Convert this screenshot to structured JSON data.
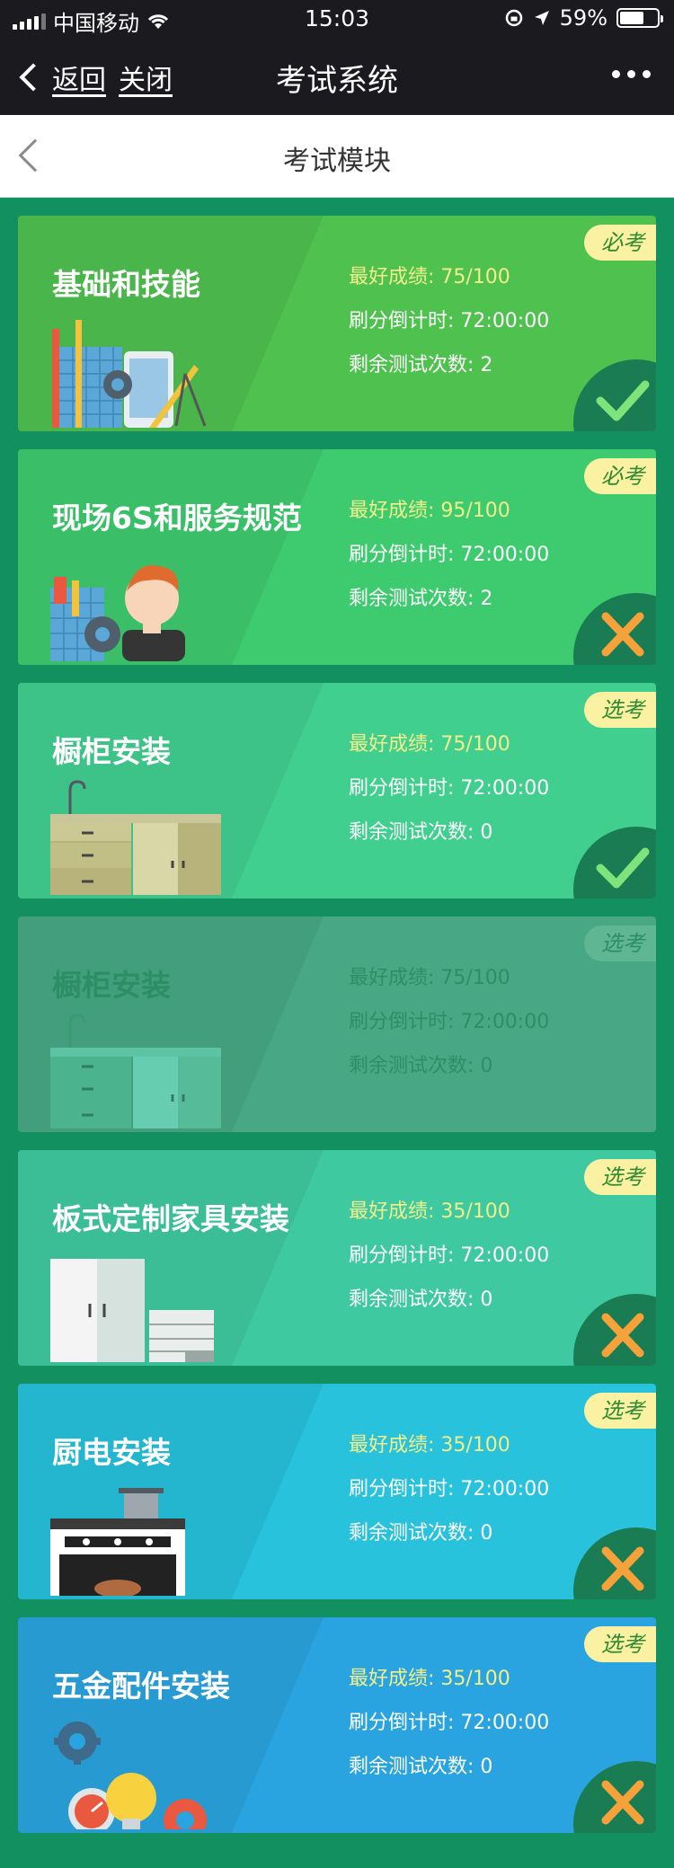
{
  "status": {
    "carrier": "中国移动",
    "time": "15:03",
    "battery": "59%"
  },
  "nav": {
    "back": "返回",
    "close": "关闭",
    "title": "考试系统"
  },
  "subbar": {
    "title": "考试模块"
  },
  "labels": {
    "best": "最好成绩: ",
    "countdown": "刷分倒计时: ",
    "remaining": "剩余测试次数: "
  },
  "cards": [
    {
      "name": "基础和技能",
      "badge": "必考",
      "best": "75/100",
      "countdown": "72:00:00",
      "remaining": "2",
      "result": "pass",
      "color": "#4fc14f"
    },
    {
      "name": "现场6S和服务规范",
      "badge": "必考",
      "best": "95/100",
      "countdown": "72:00:00",
      "remaining": "2",
      "result": "fail",
      "color": "#3ecb6f"
    },
    {
      "name": "橱柜安装",
      "badge": "选考",
      "best": "75/100",
      "countdown": "72:00:00",
      "remaining": "0",
      "result": "pass",
      "color": "#41cf90"
    },
    {
      "name": "橱柜安装",
      "badge": "选考",
      "best": "75/100",
      "countdown": "72:00:00",
      "remaining": "0",
      "result": "none",
      "color": "#48a886",
      "disabled": true
    },
    {
      "name": "板式定制家具安装",
      "badge": "选考",
      "best": "35/100",
      "countdown": "72:00:00",
      "remaining": "0",
      "result": "fail",
      "color": "#3fc9a0"
    },
    {
      "name": "厨电安装",
      "badge": "选考",
      "best": "35/100",
      "countdown": "72:00:00",
      "remaining": "0",
      "result": "fail",
      "color": "#28c2dc"
    },
    {
      "name": "五金配件安装",
      "badge": "选考",
      "best": "35/100",
      "countdown": "72:00:00",
      "remaining": "0",
      "result": "fail",
      "color": "#2aa4e0"
    }
  ],
  "colors": {
    "pass_mark": "#7ee37a",
    "fail_mark": "#f7a13a",
    "badge_text": "#2f8a33",
    "best_text": "#f2f08a"
  }
}
